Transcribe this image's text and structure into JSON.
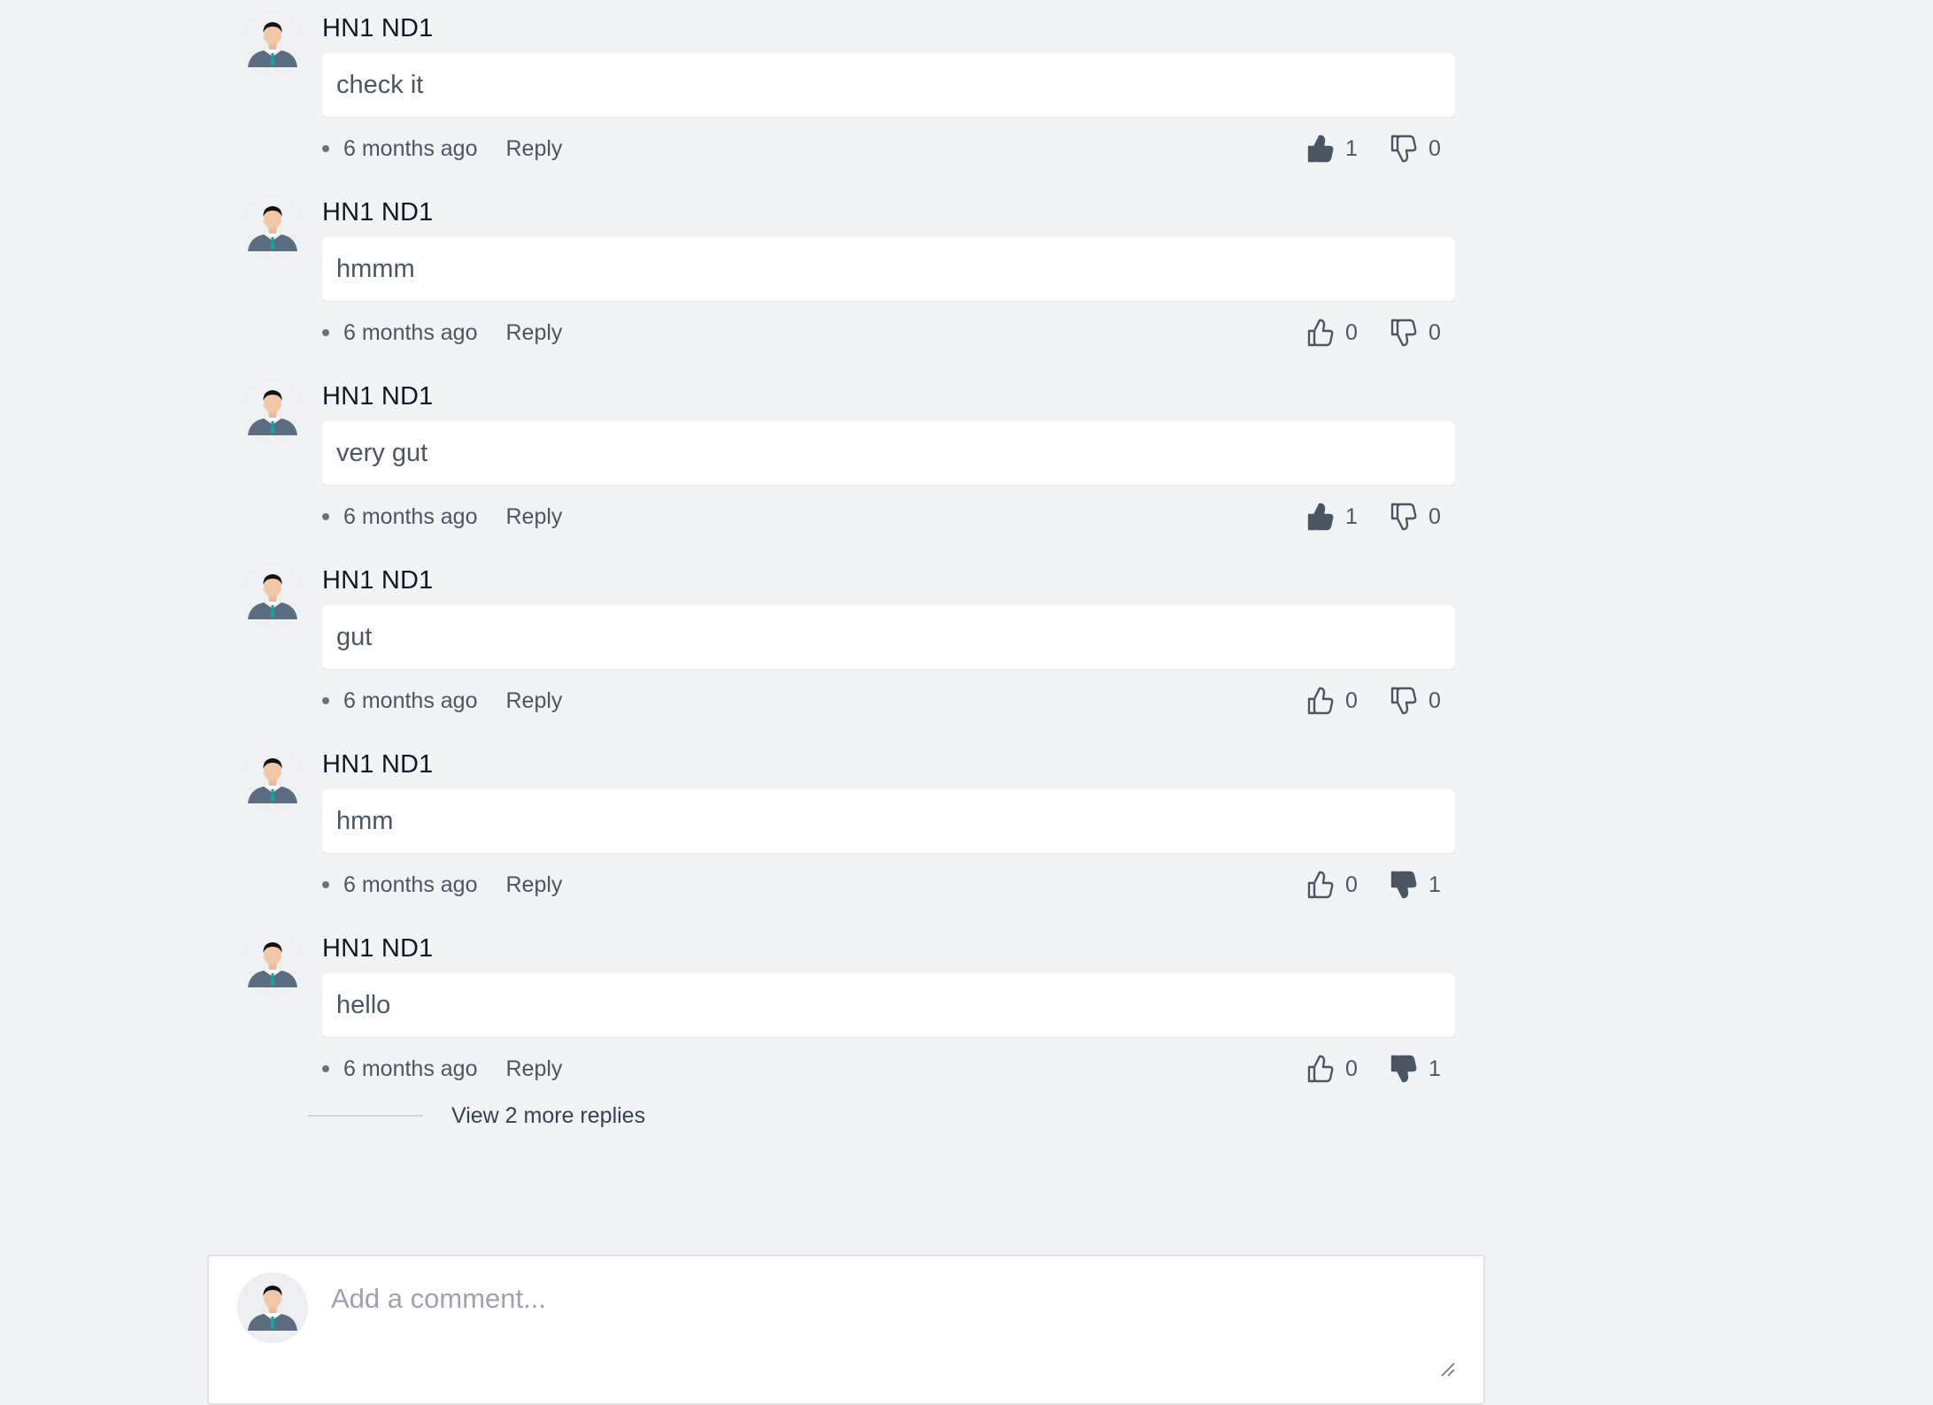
{
  "comments": [
    {
      "author": "HN1 ND1",
      "text": "check it",
      "time": "6 months ago",
      "reply_label": "Reply",
      "likes": "1",
      "dislikes": "0",
      "liked": true,
      "disliked": false
    },
    {
      "author": "HN1 ND1",
      "text": "hmmm",
      "time": "6 months ago",
      "reply_label": "Reply",
      "likes": "0",
      "dislikes": "0",
      "liked": false,
      "disliked": false
    },
    {
      "author": "HN1 ND1",
      "text": "very gut",
      "time": "6 months ago",
      "reply_label": "Reply",
      "likes": "1",
      "dislikes": "0",
      "liked": true,
      "disliked": false
    },
    {
      "author": "HN1 ND1",
      "text": "gut",
      "time": "6 months ago",
      "reply_label": "Reply",
      "likes": "0",
      "dislikes": "0",
      "liked": false,
      "disliked": false
    },
    {
      "author": "HN1 ND1",
      "text": "hmm",
      "time": "6 months ago",
      "reply_label": "Reply",
      "likes": "0",
      "dislikes": "1",
      "liked": false,
      "disliked": true
    },
    {
      "author": "HN1 ND1",
      "text": "hello",
      "time": "6 months ago",
      "reply_label": "Reply",
      "likes": "0",
      "dislikes": "1",
      "liked": false,
      "disliked": true
    }
  ],
  "view_more_label": "View 2 more replies",
  "composer": {
    "placeholder": "Add a comment..."
  },
  "icons": {
    "avatar": "user-avatar-icon",
    "like": "thumbs-up-icon",
    "dislike": "thumbs-down-icon",
    "resize": "resize-grip-icon"
  },
  "colors": {
    "background": "#f2f3f5",
    "bubble": "#ffffff",
    "icon": "#4b5563",
    "muted_text": "#4b5563"
  }
}
